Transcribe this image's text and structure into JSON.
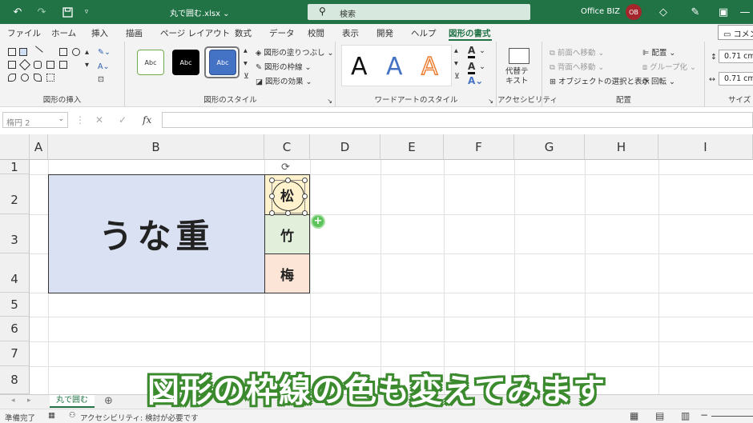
{
  "titlebar": {
    "doc_title": "丸で囲む.xlsx ⌄",
    "search_placeholder": "検索",
    "user_name": "Office BIZ",
    "avatar_initials": "OB"
  },
  "tabs": [
    "ファイル",
    "ホーム",
    "挿入",
    "描画",
    "ページ レイアウト",
    "数式",
    "データ",
    "校閲",
    "表示",
    "開発",
    "ヘルプ",
    "図形の書式"
  ],
  "comment_label": "コメント",
  "ribbon": {
    "insert_shapes": {
      "label": "図形の挿入"
    },
    "shape_styles": {
      "label": "図形のスタイル",
      "presets": [
        "Abc",
        "Abc",
        "Abc"
      ],
      "fill": "図形の塗りつぶし",
      "outline": "図形の枠線",
      "effects": "図形の効果"
    },
    "wordart": {
      "label": "ワードアートのスタイル",
      "letters": [
        "A",
        "A",
        "A"
      ]
    },
    "accessibility": {
      "label": "アクセシビリティ",
      "alt_text": "代替テ\nキスト"
    },
    "arrange": {
      "label": "配置",
      "bring_forward": "前面へ移動",
      "send_backward": "背面へ移動",
      "selection_pane": "オブジェクトの選択と表示",
      "align": "配置",
      "group": "グループ化",
      "rotate": "回転"
    },
    "size": {
      "label": "サイズ",
      "height": "0.71 cm",
      "width": "0.71 cm"
    }
  },
  "formula_bar": {
    "name_box": "楕円 2"
  },
  "columns": [
    "A",
    "B",
    "C",
    "D",
    "E",
    "F",
    "G",
    "H",
    "I"
  ],
  "rows": [
    "1",
    "2",
    "3",
    "4",
    "5",
    "6",
    "7",
    "8"
  ],
  "cells": {
    "menu_title": "うな重",
    "grade_1": "松",
    "grade_2": "竹",
    "grade_3": "梅"
  },
  "sheet_tab": "丸で囲む",
  "status": {
    "ready": "準備完了",
    "accessibility": "アクセシビリティ: 検討が必要です"
  },
  "caption": "図形の枠線の色も変えてみます",
  "colors": {
    "accent": "#217346",
    "title_cell": "#d9e1f2",
    "cell_matsu": "#fff2cc",
    "cell_take": "#e2efda",
    "cell_ume": "#fce4d6",
    "caption_outline": "#3b8a2e"
  }
}
